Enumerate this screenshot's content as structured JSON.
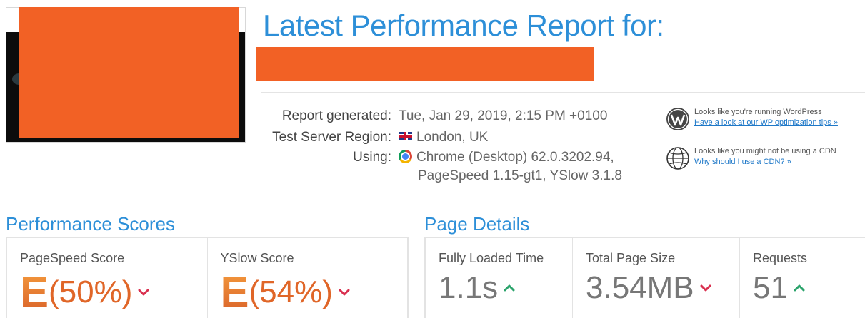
{
  "header": {
    "title": "Latest Performance Report for:"
  },
  "report_meta": {
    "generated_label": "Report generated:",
    "generated_value": "Tue, Jan 29, 2019, 2:15 PM +0100",
    "region_label": "Test Server Region:",
    "region_value": "London, UK",
    "using_label": "Using:",
    "using_value_line1": "Chrome (Desktop) 62.0.3202.94,",
    "using_value_line2": "PageSpeed 1.15-gt1, YSlow 3.1.8",
    "region_icon": "uk-flag-icon",
    "browser_icon": "chrome-icon"
  },
  "notices": [
    {
      "icon": "wordpress-icon",
      "text": "Looks like you're running WordPress",
      "link": "Have a look at our WP optimization tips »"
    },
    {
      "icon": "globe-icon",
      "text": "Looks like you might not be using a CDN",
      "link": "Why should I use a CDN? »"
    }
  ],
  "performance_scores": {
    "title": "Performance Scores",
    "pagespeed": {
      "label": "PageSpeed Score",
      "grade": "E",
      "percent": "(50%)",
      "trend": "down"
    },
    "yslow": {
      "label": "YSlow Score",
      "grade": "E",
      "percent": "(54%)",
      "trend": "down"
    }
  },
  "page_details": {
    "title": "Page Details",
    "loaded": {
      "label": "Fully Loaded Time",
      "value": "1.1s",
      "trend": "up"
    },
    "size": {
      "label": "Total Page Size",
      "value": "3.54MB",
      "trend": "down"
    },
    "requests": {
      "label": "Requests",
      "value": "51",
      "trend": "up"
    }
  },
  "colors": {
    "accent_blue": "#2d8fd8",
    "grade_orange": "#e87722",
    "redaction": "#f26125",
    "trend_up": "#2aa36b",
    "trend_down": "#d9304f"
  }
}
